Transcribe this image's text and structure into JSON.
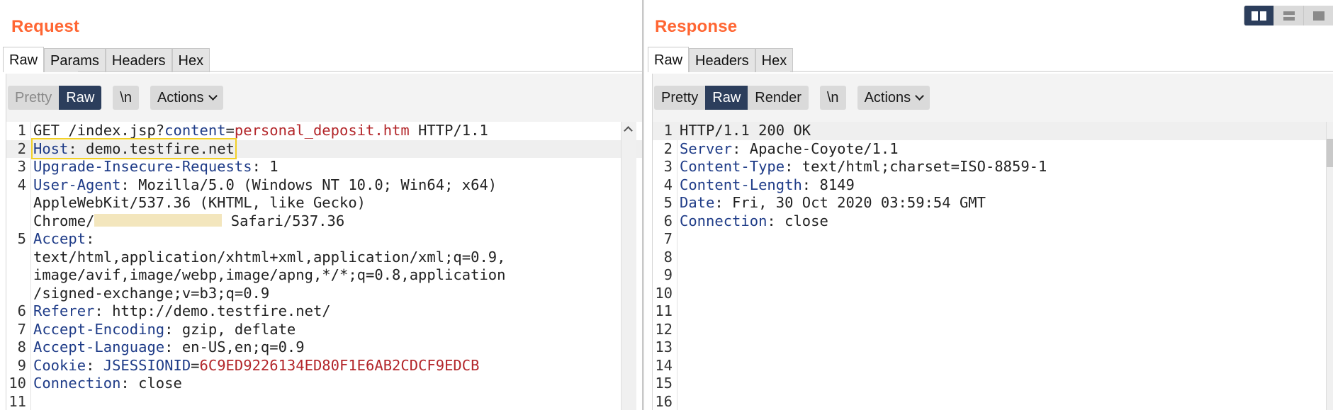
{
  "request": {
    "title": "Request",
    "tabs": [
      "Raw",
      "Params",
      "Headers",
      "Hex"
    ],
    "active_tab": "Raw",
    "toolbar": {
      "pretty": "Pretty",
      "raw": "Raw",
      "newline": "\\n",
      "actions": "Actions"
    },
    "lines": [
      {
        "n": "1",
        "parts": [
          {
            "c": "t",
            "s": "GET /index.jsp?"
          },
          {
            "c": "p",
            "s": "content"
          },
          {
            "c": "t",
            "s": "="
          },
          {
            "c": "v",
            "s": "personal_deposit.htm"
          },
          {
            "c": "t",
            "s": " HTTP/1.1"
          }
        ]
      },
      {
        "n": "2",
        "hl": true,
        "box": true,
        "parts": [
          {
            "c": "k",
            "s": "Host"
          },
          {
            "c": "t",
            "s": ": demo.testfire.net"
          }
        ]
      },
      {
        "n": "3",
        "parts": [
          {
            "c": "k",
            "s": "Upgrade-Insecure-Requests"
          },
          {
            "c": "t",
            "s": ": 1"
          }
        ]
      },
      {
        "n": "4",
        "parts": [
          {
            "c": "k",
            "s": "User-Agent"
          },
          {
            "c": "t",
            "s": ": Mozilla/5.0 (Windows NT 10.0; Win64; x64)"
          }
        ]
      },
      {
        "n": "",
        "parts": [
          {
            "c": "t",
            "s": "AppleWebKit/537.36 (KHTML, like Gecko)"
          }
        ]
      },
      {
        "n": "",
        "redact": true,
        "parts": [
          {
            "c": "t",
            "s": "Chrome/"
          },
          {
            "c": "r",
            "s": ""
          },
          {
            "c": "t",
            "s": " Safari/537.36"
          }
        ]
      },
      {
        "n": "5",
        "parts": [
          {
            "c": "k",
            "s": "Accept"
          },
          {
            "c": "t",
            "s": ":"
          }
        ]
      },
      {
        "n": "",
        "parts": [
          {
            "c": "t",
            "s": "text/html,application/xhtml+xml,application/xml;q=0.9,"
          }
        ]
      },
      {
        "n": "",
        "parts": [
          {
            "c": "t",
            "s": "image/avif,image/webp,image/apng,*/*;q=0.8,application"
          }
        ]
      },
      {
        "n": "",
        "parts": [
          {
            "c": "t",
            "s": "/signed-exchange;v=b3;q=0.9"
          }
        ]
      },
      {
        "n": "6",
        "parts": [
          {
            "c": "k",
            "s": "Referer"
          },
          {
            "c": "t",
            "s": ": http://demo.testfire.net/"
          }
        ]
      },
      {
        "n": "7",
        "parts": [
          {
            "c": "k",
            "s": "Accept-Encoding"
          },
          {
            "c": "t",
            "s": ": gzip, deflate"
          }
        ]
      },
      {
        "n": "8",
        "parts": [
          {
            "c": "k",
            "s": "Accept-Language"
          },
          {
            "c": "t",
            "s": ": en-US,en;q=0.9"
          }
        ]
      },
      {
        "n": "9",
        "parts": [
          {
            "c": "k",
            "s": "Cookie"
          },
          {
            "c": "t",
            "s": ": "
          },
          {
            "c": "p",
            "s": "JSESSIONID"
          },
          {
            "c": "t",
            "s": "="
          },
          {
            "c": "v",
            "s": "6C9ED9226134ED80F1E6AB2CDCF9EDCB"
          }
        ]
      },
      {
        "n": "10",
        "parts": [
          {
            "c": "k",
            "s": "Connection"
          },
          {
            "c": "t",
            "s": ": close"
          }
        ]
      },
      {
        "n": "11",
        "parts": []
      }
    ]
  },
  "response": {
    "title": "Response",
    "tabs": [
      "Raw",
      "Headers",
      "Hex"
    ],
    "active_tab": "Raw",
    "toolbar": {
      "pretty": "Pretty",
      "raw": "Raw",
      "render": "Render",
      "newline": "\\n",
      "actions": "Actions"
    },
    "lines": [
      {
        "n": "1",
        "hl": true,
        "parts": [
          {
            "c": "t",
            "s": "HTTP/1.1 200 OK"
          }
        ]
      },
      {
        "n": "2",
        "parts": [
          {
            "c": "k",
            "s": "Server"
          },
          {
            "c": "t",
            "s": ": Apache-Coyote/1.1"
          }
        ]
      },
      {
        "n": "3",
        "parts": [
          {
            "c": "k",
            "s": "Content-Type"
          },
          {
            "c": "t",
            "s": ": text/html;charset=ISO-8859-1"
          }
        ]
      },
      {
        "n": "4",
        "parts": [
          {
            "c": "k",
            "s": "Content-Length"
          },
          {
            "c": "t",
            "s": ": 8149"
          }
        ]
      },
      {
        "n": "5",
        "parts": [
          {
            "c": "k",
            "s": "Date"
          },
          {
            "c": "t",
            "s": ": Fri, 30 Oct 2020 03:59:54 GMT"
          }
        ]
      },
      {
        "n": "6",
        "parts": [
          {
            "c": "k",
            "s": "Connection"
          },
          {
            "c": "t",
            "s": ": close"
          }
        ]
      },
      {
        "n": "7",
        "parts": []
      },
      {
        "n": "8",
        "parts": []
      },
      {
        "n": "9",
        "parts": []
      },
      {
        "n": "10",
        "parts": []
      },
      {
        "n": "11",
        "parts": []
      },
      {
        "n": "12",
        "parts": []
      },
      {
        "n": "13",
        "parts": []
      },
      {
        "n": "14",
        "parts": []
      },
      {
        "n": "15",
        "parts": []
      },
      {
        "n": "16",
        "parts": []
      }
    ]
  },
  "layout_toggle": [
    "columns-layout-icon",
    "rows-layout-icon",
    "single-layout-icon"
  ],
  "colors": {
    "title": "#ff6633",
    "selected": "#2c3e5c",
    "header_name": "#1f3c88",
    "value": "#b3262a",
    "highlight_box": "#f2d027"
  }
}
